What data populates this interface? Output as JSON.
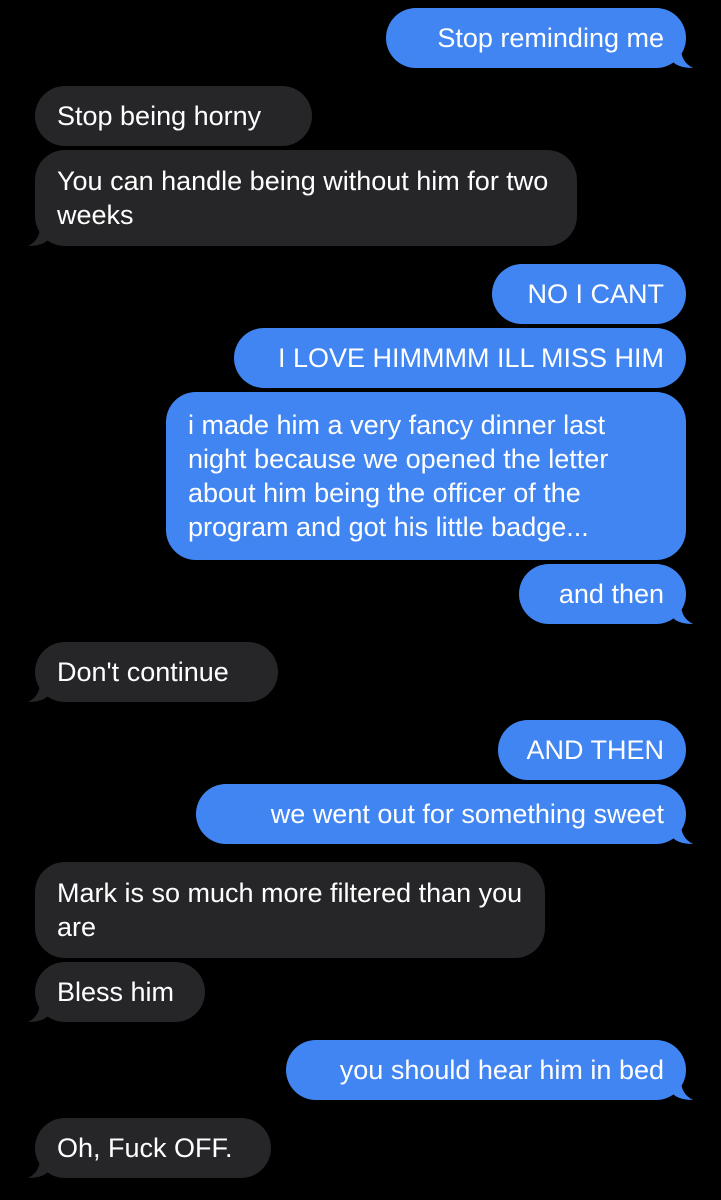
{
  "colors": {
    "background": "#000000",
    "sent_bubble": "#4185f2",
    "received_bubble": "#262629",
    "text": "#ffffff"
  },
  "messages": [
    {
      "direction": "sent",
      "text": "Stop reminding me"
    },
    {
      "direction": "received",
      "text": "Stop being horny"
    },
    {
      "direction": "received",
      "text": "You can handle being without him for two weeks"
    },
    {
      "direction": "sent",
      "text": "NO I CANT"
    },
    {
      "direction": "sent",
      "text": "I LOVE HIMMMM ILL MISS HIM"
    },
    {
      "direction": "sent",
      "text": "i made him a very fancy dinner last night because we opened the letter about him being the officer of the program and got his little badge..."
    },
    {
      "direction": "sent",
      "text": "and then"
    },
    {
      "direction": "received",
      "text": "Don't continue"
    },
    {
      "direction": "sent",
      "text": "AND THEN"
    },
    {
      "direction": "sent",
      "text": "we went out for something sweet"
    },
    {
      "direction": "received",
      "text": "Mark is so much more filtered than you are"
    },
    {
      "direction": "received",
      "text": "Bless him"
    },
    {
      "direction": "sent",
      "text": "you should hear him in bed"
    },
    {
      "direction": "received",
      "text": "Oh, Fuck OFF."
    }
  ]
}
